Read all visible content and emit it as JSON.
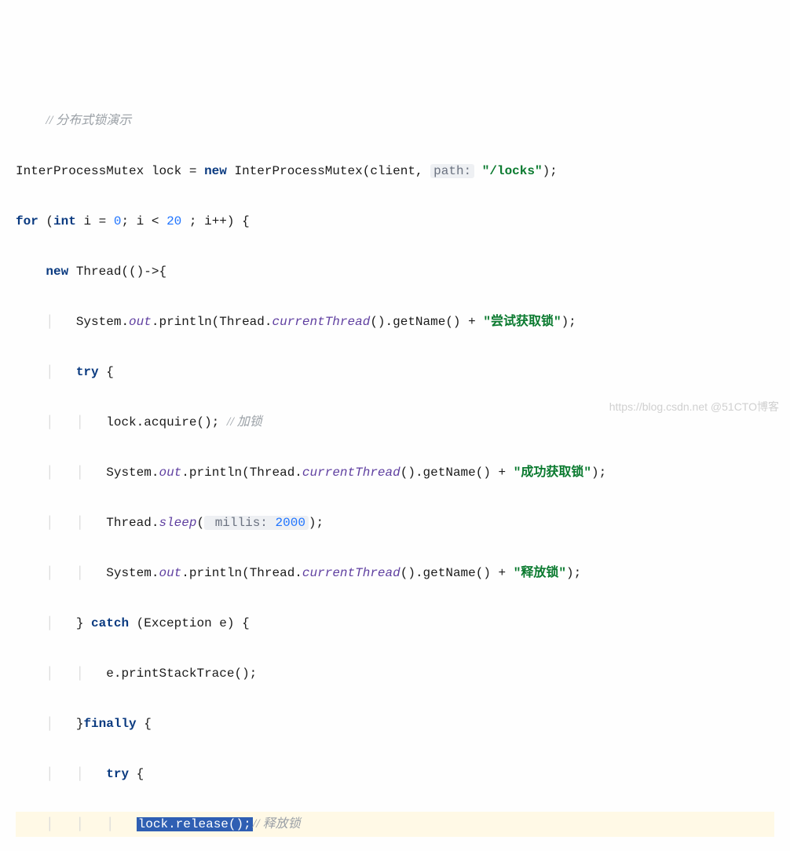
{
  "code": {
    "l1_cm": "// 分布式锁演示",
    "l2_kw_new": "new",
    "l2_type": "InterProcessMutex",
    "l2_var": "lock",
    "l2_eq": " = ",
    "l2_ctor": "InterProcessMutex",
    "l2_client": "client",
    "l2_hint_label": "path:",
    "l2_str": "\"/locks\"",
    "l3_for": "for",
    "l3_int": "int",
    "l3_i": "i",
    "l3_eq": " = ",
    "l3_zero": "0",
    "l3_cond": "; i < ",
    "l3_twenty": "20",
    "l3_inc": " ; i++) {",
    "l4_new": "new",
    "l4_thread": " Thread(()->{",
    "l5_sys": "System.",
    "l5_out": "out",
    "l5_println": ".println(Thread.",
    "l5_ct": "currentThread",
    "l5_getname": "().getName() + ",
    "l5_str": "\"尝试获取锁\"",
    "l5_end": ");",
    "l6_try": "try",
    "l6_brace": " {",
    "l7_lock": "lock.acquire(); ",
    "l7_cm": "// 加锁",
    "l8_sys": "System.",
    "l8_out": "out",
    "l8_println": ".println(Thread.",
    "l8_ct": "currentThread",
    "l8_getname": "().getName() + ",
    "l8_str": "\"成功获取锁\"",
    "l8_end": ");",
    "l9_thread": "Thread.",
    "l9_sleep": "sleep",
    "l9_hint_label": " millis:",
    "l9_hint_val": "2000",
    "l9_end": ");",
    "l10_sys": "System.",
    "l10_out": "out",
    "l10_println": ".println(Thread.",
    "l10_ct": "currentThread",
    "l10_getname": "().getName() + ",
    "l10_str": "\"释放锁\"",
    "l10_end": ");",
    "l11_close": "} ",
    "l11_catch": "catch",
    "l11_exc": " (Exception e) {",
    "l12_eprint": "e.printStackTrace();",
    "l13_close": "}",
    "l13_finally": "finally",
    "l13_brace": " {",
    "l14_try": "try",
    "l14_brace": " {",
    "l15_sel": "lock.release();",
    "l15_cm": "// 释放锁"
  },
  "watermark": "https://blog.csdn.net @51CTO博客"
}
